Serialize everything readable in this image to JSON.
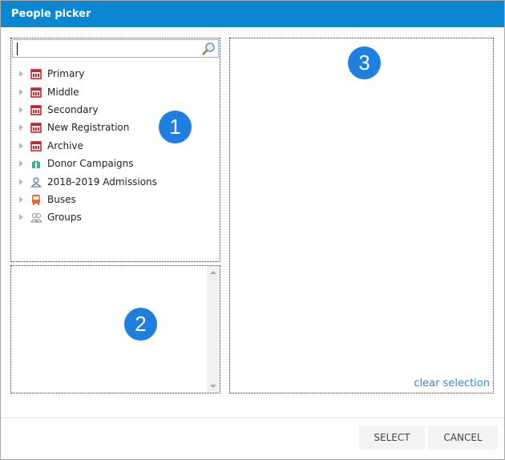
{
  "title": "People picker",
  "search": {
    "value": ""
  },
  "tree": [
    {
      "label": "Primary",
      "icon": "school-icon",
      "color": "#c8242b"
    },
    {
      "label": "Middle",
      "icon": "school-icon",
      "color": "#c8242b"
    },
    {
      "label": "Secondary",
      "icon": "school-icon",
      "color": "#c8242b"
    },
    {
      "label": "New Registration",
      "icon": "school-icon",
      "color": "#c8242b"
    },
    {
      "label": "Archive",
      "icon": "school-icon",
      "color": "#c8242b"
    },
    {
      "label": "Donor Campaigns",
      "icon": "gift-icon",
      "color": "#3bb39a"
    },
    {
      "label": "2018-2019 Admissions",
      "icon": "person-icon",
      "color": "#5a7f9a"
    },
    {
      "label": "Buses",
      "icon": "bus-icon",
      "color": "#f26522"
    },
    {
      "label": "Groups",
      "icon": "group-icon",
      "color": "#888888"
    }
  ],
  "badges": {
    "one": "1",
    "two": "2",
    "three": "3"
  },
  "clear_selection": "clear selection",
  "buttons": {
    "select": "SELECT",
    "cancel": "CANCEL"
  }
}
